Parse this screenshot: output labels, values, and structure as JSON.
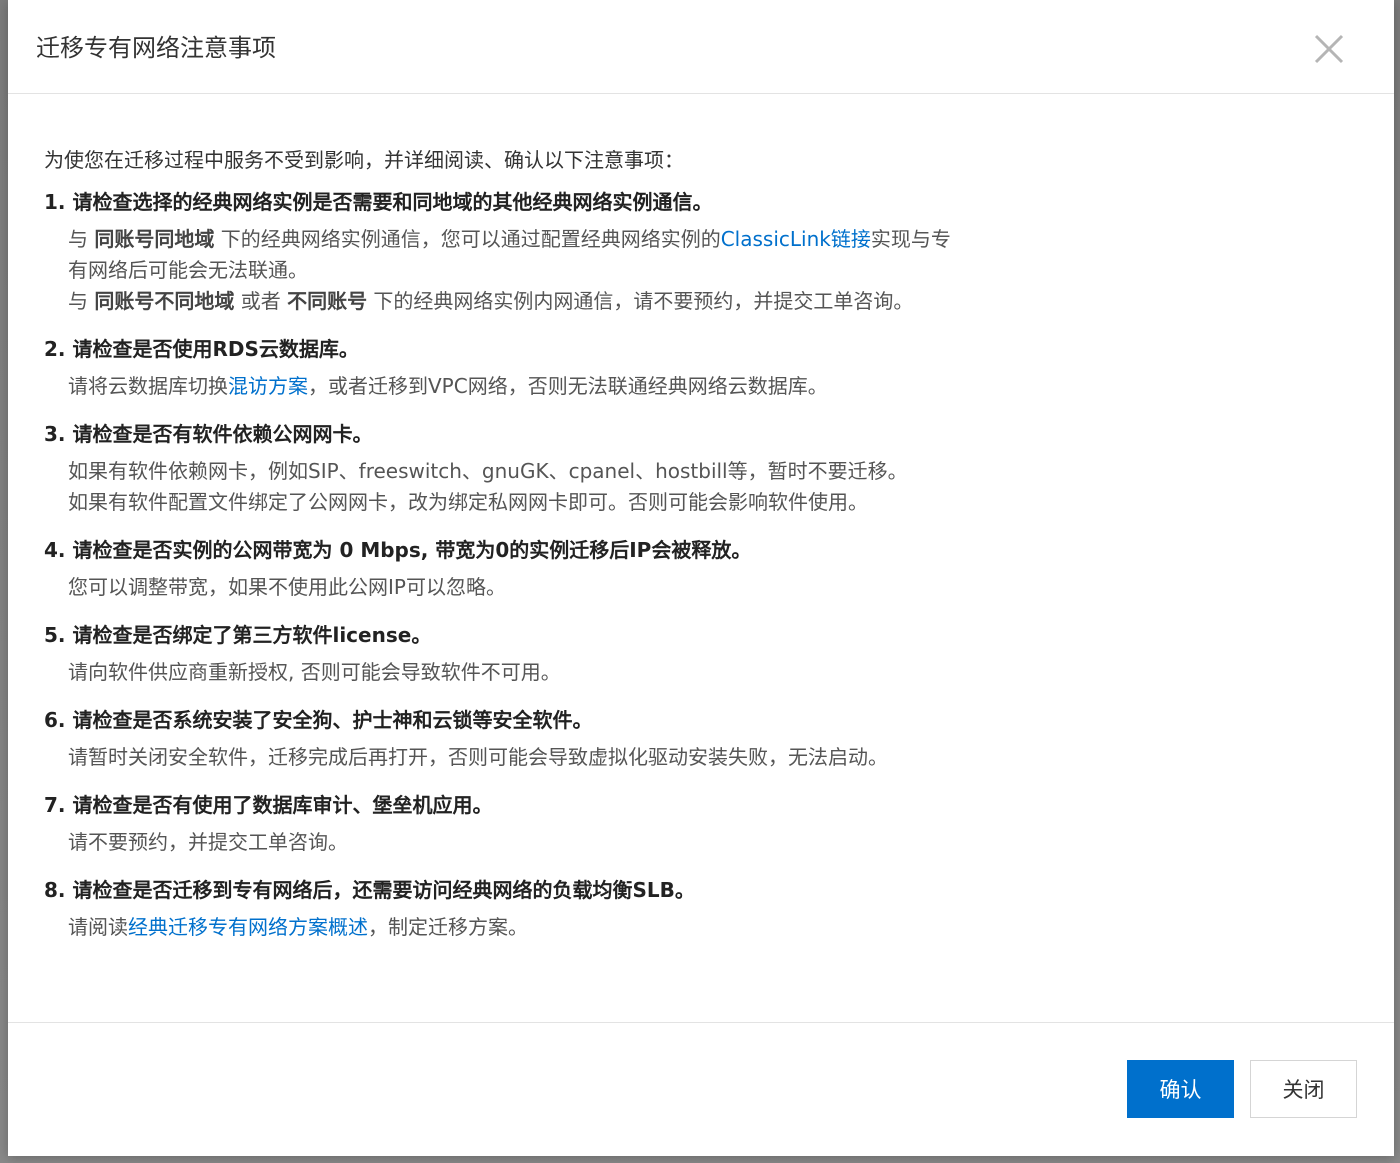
{
  "dialog": {
    "title": "迁移专有网络注意事项",
    "close_icon": "close-icon"
  },
  "intro": "为使您在迁移过程中服务不受到影响，并详细阅读、确认以下注意事项：",
  "items": [
    {
      "title": "1. 请检查选择的经典网络实例是否需要和同地域的其他经典网络实例通信。",
      "line1": {
        "a": "与 ",
        "b": "同账号同地域",
        "c": " 下的经典网络实例通信，您可以通过配置经典网络实例的",
        "link": "ClassicLink链接",
        "d": "实现与专"
      },
      "line2": "有网络后可能会无法联通。",
      "line3": {
        "a": "与 ",
        "b": "同账号不同地域",
        "c": " 或者 ",
        "d": "不同账号",
        "e": " 下的经典网络实例内网通信，请不要预约，并提交工单咨询。"
      }
    },
    {
      "title": "2. 请检查是否使用RDS云数据库。",
      "pre": "请将云数据库切换",
      "link": "混访方案",
      "post": "，或者迁移到VPC网络，否则无法联通经典网络云数据库。"
    },
    {
      "title": "3. 请检查是否有软件依赖公网网卡。",
      "line1": "如果有软件依赖网卡，例如SIP、freeswitch、gnuGK、cpanel、hostbill等，暂时不要迁移。",
      "line2": "如果有软件配置文件绑定了公网网卡，改为绑定私网网卡即可。否则可能会影响软件使用。"
    },
    {
      "title": "4. 请检查是否实例的公网带宽为 0 Mbps, 带宽为0的实例迁移后IP会被释放。",
      "line1": "您可以调整带宽，如果不使用此公网IP可以忽略。"
    },
    {
      "title": "5. 请检查是否绑定了第三方软件license。",
      "line1": "请向软件供应商重新授权, 否则可能会导致软件不可用。"
    },
    {
      "title": "6. 请检查是否系统安装了安全狗、护士神和云锁等安全软件。",
      "line1": "请暂时关闭安全软件，迁移完成后再打开，否则可能会导致虚拟化驱动安装失败，无法启动。"
    },
    {
      "title": "7. 请检查是否有使用了数据库审计、堡垒机应用。",
      "line1": "请不要预约，并提交工单咨询。"
    },
    {
      "title": "8. 请检查是否迁移到专有网络后，还需要访问经典网络的负载均衡SLB。",
      "pre": "请阅读",
      "link": "经典迁移专有网络方案概述",
      "post": "，制定迁移方案。"
    }
  ],
  "footer": {
    "confirm_label": "确认",
    "close_label": "关闭"
  },
  "colors": {
    "primary": "#0070cc",
    "link": "#0070cc",
    "title_text": "#333333",
    "body_text": "#555555"
  }
}
